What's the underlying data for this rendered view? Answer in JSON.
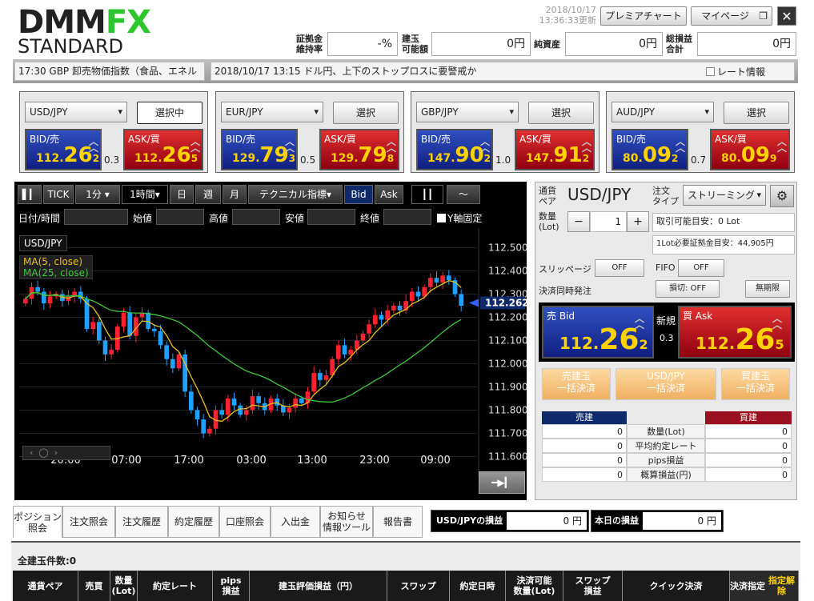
{
  "header": {
    "logo_a": "DMM",
    "logo_b": "FX",
    "logo_sub": "STANDARD",
    "date": "2018/10/17",
    "time": "13:36:33更新",
    "premium_chart": "プレミアチャート",
    "mypage": "マイページ",
    "close": "✕",
    "margin_label": "証拠金\n維持率",
    "margin_value": "-%",
    "avail_label": "建玉\n可能額",
    "avail_value": "0円",
    "net_label": "純資産",
    "net_value": "0円",
    "pl_label": "総損益\n合計",
    "pl_value": "0円"
  },
  "ticker": {
    "left": "17:30 GBP 卸売物価指数（食品、エネル",
    "news": "2018/10/17 13:15 ドル円、上下のストップロスに要警戒か",
    "rate_info": "レート情報"
  },
  "pairs": [
    {
      "name": "USD/JPY",
      "btn": "選択中",
      "bid_label": "BID/売",
      "ask_label": "ASK/買",
      "bid_s": "112.",
      "bid_b": "26",
      "bid_t": "2",
      "ask_s": "112.",
      "ask_b": "26",
      "ask_t": "5",
      "spread": "0.3"
    },
    {
      "name": "EUR/JPY",
      "btn": "選択",
      "bid_label": "BID/売",
      "ask_label": "ASK/買",
      "bid_s": "129.",
      "bid_b": "79",
      "bid_t": "3",
      "ask_s": "129.",
      "ask_b": "79",
      "ask_t": "8",
      "spread": "0.5"
    },
    {
      "name": "GBP/JPY",
      "btn": "選択",
      "bid_label": "BID/売",
      "ask_label": "ASK/買",
      "bid_s": "147.",
      "bid_b": "90",
      "bid_t": "2",
      "ask_s": "147.",
      "ask_b": "91",
      "ask_t": "2",
      "spread": "1.0"
    },
    {
      "name": "AUD/JPY",
      "btn": "選択",
      "bid_label": "BID/売",
      "ask_label": "ASK/買",
      "bid_s": "80.",
      "bid_b": "09",
      "bid_t": "2",
      "ask_s": "80.",
      "ask_b": "09",
      "ask_t": "9",
      "spread": "0.7"
    }
  ],
  "chart": {
    "tick": "TICK",
    "m1": "1分",
    "h1": "1時間",
    "day": "日",
    "week": "週",
    "month": "月",
    "tech": "テクニカル指標",
    "bid": "Bid",
    "ask": "Ask",
    "f_date": "日付/時間",
    "f_open": "始値",
    "f_high": "高値",
    "f_low": "安値",
    "f_close": "終値",
    "yfix": "Y軸固定",
    "symbol": "USD/JPY",
    "ma5": "MA(5, close)",
    "ma25": "MA(25, close)",
    "current": "112.262",
    "ma5_color": "#e8c020",
    "ma25_color": "#3ec83e",
    "up_color": "#ff2030",
    "down_color": "#20a0ff"
  },
  "chart_data": {
    "type": "candlestick",
    "yticks": [
      "112.500",
      "112.400",
      "112.300",
      "112.200",
      "112.100",
      "112.000",
      "111.900",
      "111.800",
      "111.700",
      "111.600"
    ],
    "ylim": [
      111.55,
      112.55
    ],
    "xticks": [
      "20:00",
      "07:00",
      "17:00",
      "03:00",
      "13:00",
      "23:00",
      "09:00"
    ],
    "closes": [
      112.28,
      112.33,
      112.31,
      112.26,
      112.29,
      112.3,
      112.27,
      112.29,
      112.31,
      112.28,
      112.15,
      112.18,
      112.1,
      112.04,
      112.06,
      112.16,
      112.22,
      112.12,
      112.2,
      112.22,
      112.15,
      112.14,
      112.08,
      112.02,
      111.98,
      112.04,
      111.88,
      111.8,
      111.76,
      111.7,
      111.72,
      111.8,
      111.78,
      111.85,
      111.82,
      111.78,
      111.8,
      111.86,
      111.83,
      111.8,
      111.85,
      111.82,
      111.79,
      111.81,
      111.85,
      111.83,
      111.88,
      111.96,
      111.93,
      111.95,
      112.02,
      112.08,
      112.04,
      112.06,
      112.1,
      112.13,
      112.17,
      112.21,
      112.19,
      112.23,
      112.25,
      112.23,
      112.27,
      112.31,
      112.29,
      112.33,
      112.37,
      112.35,
      112.38,
      112.36,
      112.3,
      112.25
    ],
    "current": 112.262
  },
  "order": {
    "pair_label": "通貨\nペア",
    "pair": "USD/JPY",
    "type_label": "注文\nタイプ",
    "type": "ストリーミング",
    "qty_label": "数量\n(Lot)",
    "qty": "1",
    "minus": "−",
    "plus": "+",
    "avail_info": "取引可能目安：0 Lot",
    "margin_info": "1Lot必要証拠金目安：44,905円",
    "slip": "スリッページ",
    "slip_v": "OFF",
    "fifo": "FIFO",
    "fifo_v": "OFF",
    "settle": "決済同時発注",
    "loss": "損切: OFF",
    "limit": "無期限",
    "bid_label": "売 Bid",
    "ask_label": "買 Ask",
    "new": "新規",
    "spread": "0.3",
    "bid_s": "112.",
    "bid_b": "26",
    "bid_t": "2",
    "ask_s": "112.",
    "ask_b": "26",
    "ask_t": "5",
    "sell_all": "売建玉\n一括決済",
    "pair_all": "USD/JPY\n一括決済",
    "buy_all": "買建玉\n一括決済",
    "sell_h": "売建",
    "buy_h": "買建",
    "rows": [
      "数量(Lot)",
      "平均約定レート",
      "pips損益",
      "概算損益(円)"
    ],
    "zero": "0"
  },
  "tabs": [
    "ポジション\n照会",
    "注文照会",
    "注文履歴",
    "約定履歴",
    "口座照会",
    "入出金",
    "お知らせ\n情報ツール",
    "報告書"
  ],
  "pl": {
    "pair_label": "USD/JPYの損益",
    "pair_value": "0 円",
    "today_label": "本日の損益",
    "today_value": "0 円"
  },
  "bottom": {
    "count": "全建玉件数:0",
    "cols": [
      "通貨ペア",
      "売買",
      "数量\n(Lot)",
      "約定レート",
      "pips\n損益",
      "建玉評価損益（円）",
      "スワップ",
      "約定日時",
      "決済可能\n数量(Lot)",
      "スワップ\n損益",
      "クイック決済",
      "決済指定"
    ],
    "extra": "指定解除"
  }
}
